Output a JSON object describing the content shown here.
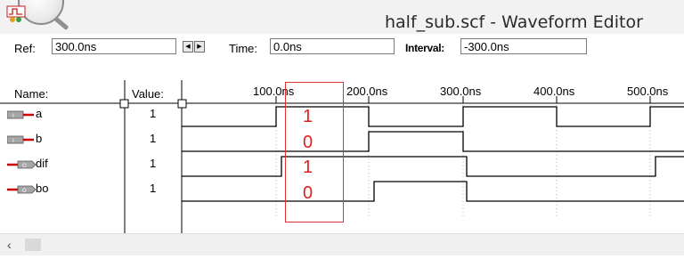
{
  "window": {
    "title": "half_sub.scf - Waveform Editor"
  },
  "toolbar": {
    "ref_label": "Ref:",
    "ref_value": "300.0ns",
    "time_label": "Time:",
    "time_value": "0.0ns",
    "interval_label": "Interval:",
    "interval_value": "-300.0ns"
  },
  "columns": {
    "name_header": "Name:",
    "value_header": "Value:"
  },
  "timeline": {
    "ticks": [
      "100.0ns",
      "200.0ns",
      "300.0ns",
      "400.0ns",
      "500.0ns"
    ]
  },
  "signals": [
    {
      "name": "a",
      "value": "1",
      "direction": "input",
      "pin_icon": "input-pin-icon"
    },
    {
      "name": "b",
      "value": "1",
      "direction": "input",
      "pin_icon": "input-pin-icon"
    },
    {
      "name": "dif",
      "value": "1",
      "direction": "output",
      "pin_icon": "output-pin-icon"
    },
    {
      "name": "bo",
      "value": "1",
      "direction": "output",
      "pin_icon": "output-pin-icon"
    }
  ],
  "annotation": {
    "values": [
      "1",
      "0",
      "1",
      "0"
    ],
    "color": "#e02020"
  },
  "colors": {
    "pin_red": "#cc0000",
    "pin_body": "#a6a6a6",
    "highlight": "#e03030"
  },
  "scrollbar": {
    "left_arrow_icon": "chevron-left-icon"
  }
}
